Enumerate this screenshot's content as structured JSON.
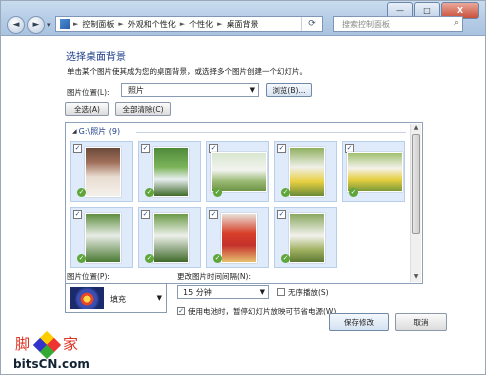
{
  "window": {
    "controls": {
      "minimize": "—",
      "maximize": "□",
      "close": "X"
    }
  },
  "nav": {
    "back": "◄",
    "forward": "►",
    "dropdown": "▾",
    "breadcrumb": [
      "控制面板",
      "外观和个性化",
      "个性化",
      "桌面背景"
    ],
    "search_placeholder": "搜索控制面板"
  },
  "main": {
    "heading": "选择桌面背景",
    "description": "单击某个图片使其成为您的桌面背景，或选择多个图片创建一个幻灯片。",
    "location_label": "图片位置(L):",
    "location_value": "照片",
    "browse_label": "浏览(B)...",
    "select_all_label": "全选(A)",
    "clear_all_label": "全部清除(C)",
    "group_header": "G:\\照片 (9)"
  },
  "thumbnails": [
    {
      "checked": true,
      "selected": true
    },
    {
      "checked": true,
      "selected": true
    },
    {
      "checked": true,
      "selected": true
    },
    {
      "checked": true,
      "selected": true
    },
    {
      "checked": true,
      "selected": true
    },
    {
      "checked": true,
      "selected": true
    },
    {
      "checked": true,
      "selected": true
    },
    {
      "checked": true,
      "selected": true
    },
    {
      "checked": true,
      "selected": true
    }
  ],
  "options": {
    "position_label": "图片位置(P):",
    "position_value": "填充",
    "interval_label": "更改图片时间间隔(N):",
    "interval_value": "15 分钟",
    "shuffle_label": "无序播放(S)",
    "shuffle_checked": false,
    "battery_label": "使用电池时，暂停幻灯片放映可节省电源(W)",
    "battery_checked": true
  },
  "footer": {
    "save_label": "保存修改",
    "cancel_label": "取消"
  },
  "watermark": {
    "logo_left": "脚",
    "logo_right": "家",
    "logo_url": "bitsCN.com"
  }
}
